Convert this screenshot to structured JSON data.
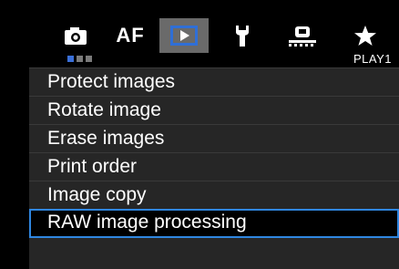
{
  "tabs": [
    {
      "name": "shooting",
      "icon": "camera-icon",
      "active": false
    },
    {
      "name": "af",
      "label": "AF",
      "active": false
    },
    {
      "name": "playback",
      "icon": "play-icon",
      "active": true
    },
    {
      "name": "setup",
      "icon": "wrench-icon",
      "active": false
    },
    {
      "name": "custom",
      "icon": "custom-function-icon",
      "active": false
    },
    {
      "name": "my-menu",
      "icon": "star-icon",
      "active": false
    }
  ],
  "page_indicator": {
    "pages": 3,
    "current": 1,
    "label": "PLAY1"
  },
  "menu_items": [
    {
      "label": "Protect images"
    },
    {
      "label": "Rotate image"
    },
    {
      "label": "Erase images"
    },
    {
      "label": "Print order"
    },
    {
      "label": "Image copy"
    },
    {
      "label": "RAW image processing",
      "selected": true
    }
  ],
  "colors": {
    "active_tab_bg": "#6a6a6a",
    "play_icon_blue": "#2f6fd6",
    "selection_border": "#2f86e0",
    "menu_bg": "#262626",
    "page_dot_active": "#3a6fd8"
  }
}
